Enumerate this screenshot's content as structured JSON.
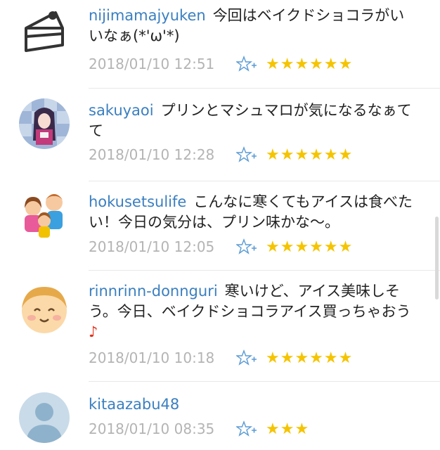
{
  "comments": [
    {
      "username": "nijimamajyuken",
      "message": "今回はベイクドショコラがいいなぁ(*'ω'*)",
      "note": "",
      "date": "2018/01/10 12:51",
      "stars": "★★★★★★",
      "avatar_icon": "cake-icon"
    },
    {
      "username": "sakuyaoi",
      "message": "プリンとマシュマロが気になるなぁてて",
      "note": "",
      "date": "2018/01/10 12:28",
      "stars": "★★★★★★",
      "avatar_icon": "anime-girl-avatar"
    },
    {
      "username": "hokusetsulife",
      "message": "こんなに寒くてもアイスは食べたい！今日の気分は、プリン味かな〜。",
      "note": "",
      "date": "2018/01/10 12:05",
      "stars": "★★★★★★",
      "avatar_icon": "family-avatar"
    },
    {
      "username": "rinnrinn-donnguri",
      "message": "寒いけど、アイス美味しそう。今日、ベイクドショコラアイス買っちゃおう",
      "note": "♪",
      "date": "2018/01/10 10:18",
      "stars": "★★★★★★",
      "avatar_icon": "smiling-face-avatar"
    },
    {
      "username": "kitaazabu48",
      "message": "",
      "note": "",
      "date": "2018/01/10 08:35",
      "stars": "★★★",
      "avatar_icon": "default-user-avatar"
    }
  ],
  "colors": {
    "username": "#3a7fc0",
    "date": "#b4b4b4",
    "star": "#f5c400",
    "add_star": "#5b9bd5",
    "note": "#e3311b"
  }
}
